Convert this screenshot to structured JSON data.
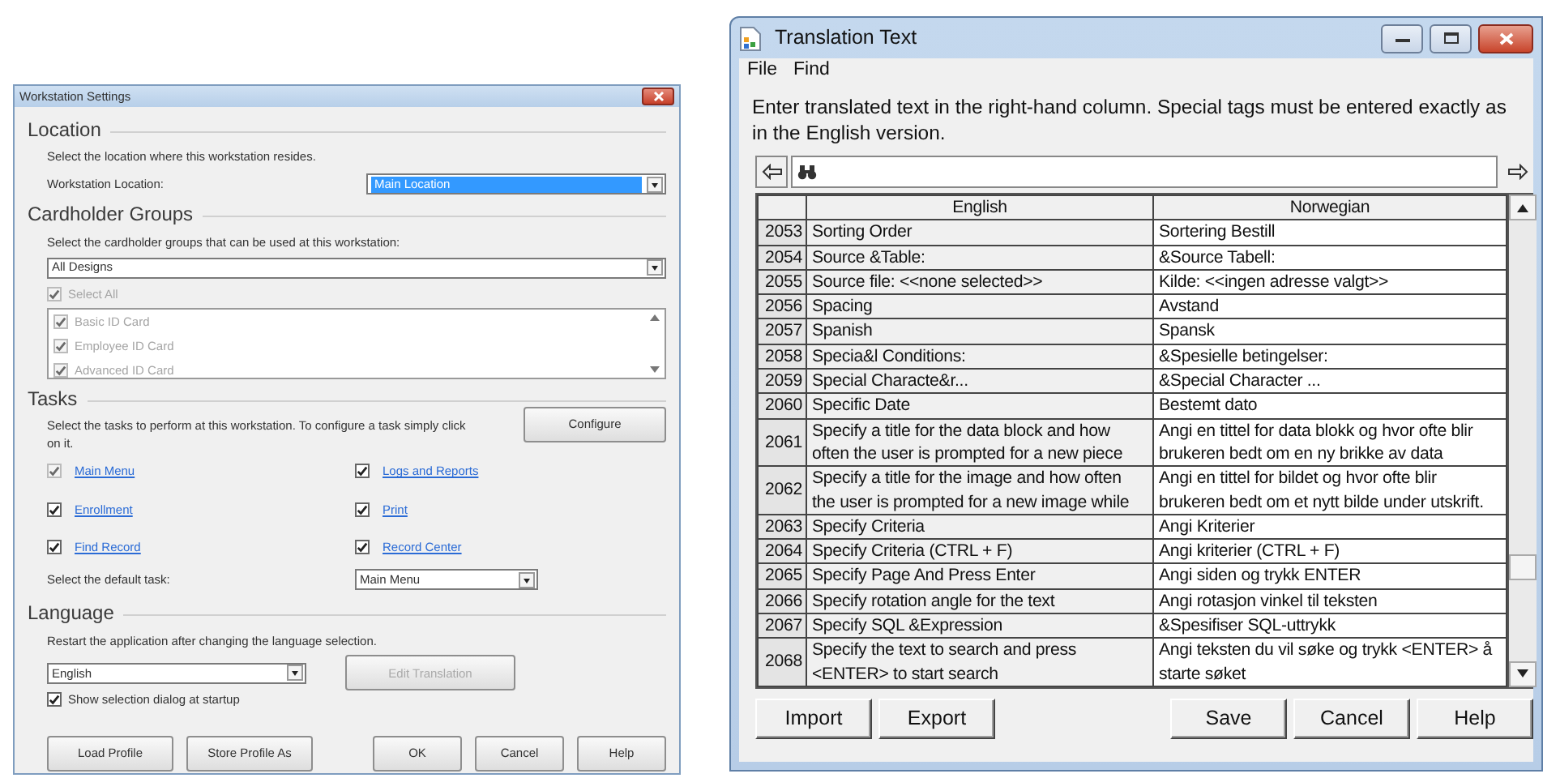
{
  "workstation_settings": {
    "title": "Workstation Settings",
    "location": {
      "heading": "Location",
      "description": "Select the location where this workstation resides.",
      "label": "Workstation Location:",
      "value": "Main Location",
      "focused": true
    },
    "cardholder_groups": {
      "heading": "Cardholder Groups",
      "description": "Select the cardholder groups that can be used at this workstation:",
      "value": "All Designs",
      "select_all": {
        "label": "Select All",
        "checked": true,
        "disabled": true
      },
      "groups": [
        {
          "label": "Basic ID Card",
          "checked": true,
          "disabled": true
        },
        {
          "label": "Employee ID Card",
          "checked": true,
          "disabled": true
        },
        {
          "label": "Advanced ID Card",
          "checked": true,
          "disabled": true
        }
      ]
    },
    "tasks": {
      "heading": "Tasks",
      "description": "Select the tasks to perform at this workstation. To configure a task simply click on it.",
      "configure_button": "Configure",
      "items": [
        {
          "label": "Main Menu",
          "checked": true,
          "disabled": true
        },
        {
          "label": "Logs and Reports",
          "checked": true,
          "disabled": false
        },
        {
          "label": "Enrollment",
          "checked": true,
          "disabled": false
        },
        {
          "label": "Print",
          "checked": true,
          "disabled": false
        },
        {
          "label": "Find Record",
          "checked": true,
          "disabled": false
        },
        {
          "label": "Record Center",
          "checked": true,
          "disabled": false
        }
      ],
      "default_label": "Select the default task:",
      "default_value": "Main Menu"
    },
    "language": {
      "heading": "Language",
      "description": "Restart the application after changing the language selection.",
      "value": "English",
      "edit_button": {
        "label": "Edit Translation",
        "disabled": true
      },
      "show_dialog": {
        "label": "Show selection dialog at startup",
        "checked": true
      }
    },
    "buttons_left": [
      "Load Profile",
      "Store Profile As"
    ],
    "buttons_right": [
      "OK",
      "Cancel",
      "Help"
    ]
  },
  "translation_text": {
    "title": "Translation Text",
    "menu": [
      "File",
      "Find"
    ],
    "instructions": "Enter translated text in the right-hand column. Special tags must be entered exactly as in the English version.",
    "columns": [
      "English",
      "Norwegian"
    ],
    "rows": [
      {
        "number": "2053",
        "english": "Sorting Order",
        "norwegian": "Sortering Bestill"
      },
      {
        "number": "2054",
        "english": "Source &Table:",
        "norwegian": "&Source Tabell:"
      },
      {
        "number": "2055",
        "english": "Source file: <<none selected>>",
        "norwegian": "Kilde: <<ingen adresse valgt>>"
      },
      {
        "number": "2056",
        "english": "Spacing",
        "norwegian": "Avstand"
      },
      {
        "number": "2057",
        "english": "Spanish",
        "norwegian": "Spansk"
      },
      {
        "number": "2058",
        "english": "Specia&l Conditions:",
        "norwegian": "&Spesielle betingelser:"
      },
      {
        "number": "2059",
        "english": "Special Characte&r...",
        "norwegian": "&Special Character ..."
      },
      {
        "number": "2060",
        "english": "Specific Date",
        "norwegian": "Bestemt dato"
      },
      {
        "number": "2061",
        "english": "Specify a title for the data block and how often the user is prompted for a new piece",
        "norwegian": "Angi en tittel for data blokk og hvor ofte blir brukeren bedt om en ny brikke av data"
      },
      {
        "number": "2062",
        "english": "Specify a title for the image and how often the user is prompted for a new image while",
        "norwegian": "Angi en tittel for bildet og hvor ofte blir brukeren bedt om et nytt bilde under utskrift."
      },
      {
        "number": "2063",
        "english": "Specify Criteria",
        "norwegian": "Angi Kriterier"
      },
      {
        "number": "2064",
        "english": "Specify Criteria (CTRL + F)",
        "norwegian": "Angi kriterier (CTRL + F)"
      },
      {
        "number": "2065",
        "english": "Specify Page And Press Enter",
        "norwegian": "Angi siden og trykk ENTER"
      },
      {
        "number": "2066",
        "english": "Specify rotation angle for the text",
        "norwegian": "Angi rotasjon vinkel til teksten"
      },
      {
        "number": "2067",
        "english": "Specify SQL &Expression",
        "norwegian": "&Spesifiser SQL-uttrykk"
      },
      {
        "number": "2068",
        "english": "Specify the text to search and press <ENTER> to start search",
        "norwegian": "Angi teksten du vil søke og trykk <ENTER> å starte søket"
      }
    ],
    "buttons_left": [
      "Import",
      "Export"
    ],
    "buttons_right": [
      "Save",
      "Cancel",
      "Help"
    ]
  }
}
